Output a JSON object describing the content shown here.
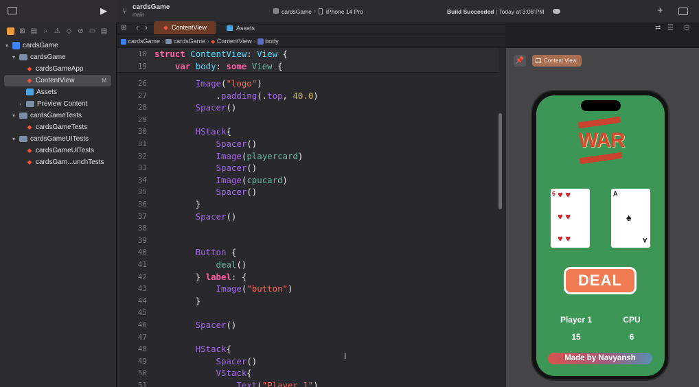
{
  "toolbar": {
    "project_name": "cardsGame",
    "branch": "main",
    "scheme": "cardsGame",
    "device": "iPhone 14 Pro",
    "status_bold": "Build Succeeded",
    "status_time": "Today at 3:08 PM"
  },
  "sidebar": {
    "items": [
      {
        "label": "cardsGame",
        "kind": "project",
        "level": 0
      },
      {
        "label": "cardsGame",
        "kind": "folder",
        "level": 1
      },
      {
        "label": "cardsGameApp",
        "kind": "swift",
        "level": 2
      },
      {
        "label": "ContentView",
        "kind": "swift",
        "level": 2,
        "badge": "M",
        "selected": true
      },
      {
        "label": "Assets",
        "kind": "asset",
        "level": 2
      },
      {
        "label": "Preview Content",
        "kind": "folder",
        "level": 2
      },
      {
        "label": "cardsGameTests",
        "kind": "folder",
        "level": 1
      },
      {
        "label": "cardsGameTests",
        "kind": "swift",
        "level": 2
      },
      {
        "label": "cardsGameUITests",
        "kind": "folder",
        "level": 1
      },
      {
        "label": "cardsGameUITests",
        "kind": "swift",
        "level": 2
      },
      {
        "label": "cardsGam...unchTests",
        "kind": "swift",
        "level": 2
      }
    ]
  },
  "tabs": [
    {
      "label": "ContentView",
      "active": true
    },
    {
      "label": "Assets",
      "active": false
    }
  ],
  "jumpbar": {
    "crumbs": [
      "cardsGame",
      "cardsGame",
      "ContentView",
      "body"
    ]
  },
  "editor": {
    "sticky": [
      {
        "num": "10",
        "code": "struct ContentView: View {"
      },
      {
        "num": "19",
        "code": "    var body: some View {"
      }
    ],
    "lines": [
      {
        "num": "26",
        "code": "        Image(\"logo\")"
      },
      {
        "num": "27",
        "code": "            .padding(.top, 40.0)"
      },
      {
        "num": "28",
        "code": "        Spacer()"
      },
      {
        "num": "29",
        "code": ""
      },
      {
        "num": "30",
        "code": "        HStack{"
      },
      {
        "num": "31",
        "code": "            Spacer()"
      },
      {
        "num": "32",
        "code": "            Image(playercard)"
      },
      {
        "num": "33",
        "code": "            Spacer()"
      },
      {
        "num": "34",
        "code": "            Image(cpucard)"
      },
      {
        "num": "35",
        "code": "            Spacer()"
      },
      {
        "num": "36",
        "code": "        }"
      },
      {
        "num": "37",
        "code": "        Spacer()"
      },
      {
        "num": "38",
        "code": ""
      },
      {
        "num": "39",
        "code": ""
      },
      {
        "num": "40",
        "code": "        Button {"
      },
      {
        "num": "41",
        "code": "            deal()"
      },
      {
        "num": "42",
        "code": "        } label: {"
      },
      {
        "num": "43",
        "code": "            Image(\"button\")"
      },
      {
        "num": "44",
        "code": "        }"
      },
      {
        "num": "45",
        "code": ""
      },
      {
        "num": "46",
        "code": "        Spacer()"
      },
      {
        "num": "47",
        "code": ""
      },
      {
        "num": "48",
        "code": "        HStack{"
      },
      {
        "num": "49",
        "code": "            Spacer()"
      },
      {
        "num": "50",
        "code": "            VStack{"
      },
      {
        "num": "51",
        "code": "                Text(\"Player 1\")"
      }
    ]
  },
  "canvas": {
    "preview_label": "Content View",
    "app": {
      "logo_text": "WAR",
      "player_card": {
        "rank": "6",
        "suit": "♥"
      },
      "cpu_card": {
        "rank": "A",
        "suit": "♠"
      },
      "deal_label": "DEAL",
      "player_label": "Player 1",
      "cpu_label": "CPU",
      "player_score": "15",
      "cpu_score": "6",
      "footer": "Made by Navyansh"
    }
  },
  "colors": {
    "accent_tab": "#6b3b25",
    "felt_green": "#3c9656",
    "deal_button": "#f07a52"
  }
}
